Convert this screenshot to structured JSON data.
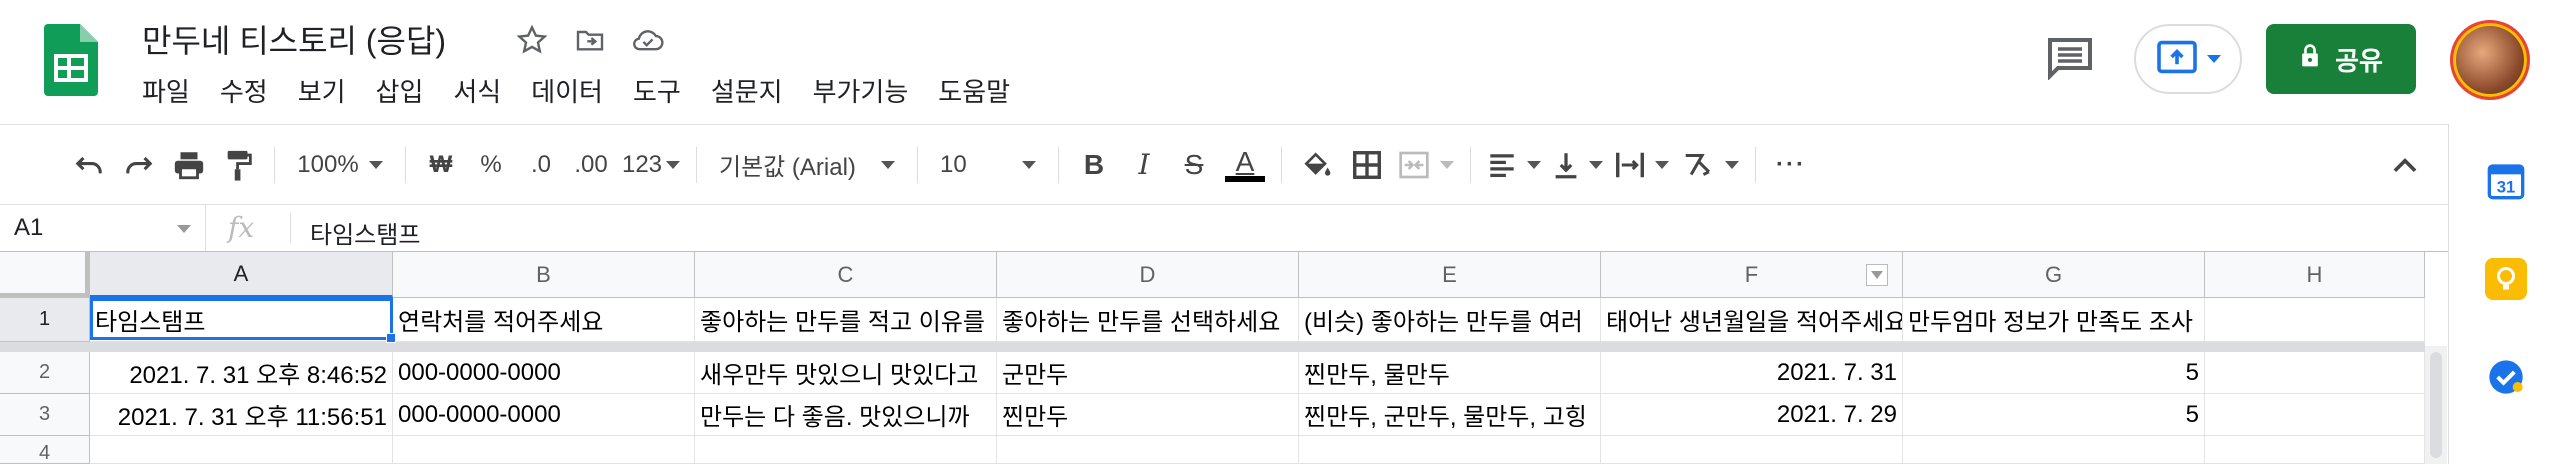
{
  "title": {
    "doc_title": "만두네 티스토리 (응답)"
  },
  "menu": [
    "파일",
    "수정",
    "보기",
    "삽입",
    "서식",
    "데이터",
    "도구",
    "설문지",
    "부가기능",
    "도움말"
  ],
  "header_buttons": {
    "share_label": "공유"
  },
  "toolbar": {
    "zoom": "100%",
    "currency": "₩",
    "percent": "%",
    "decimal_dec": ".0",
    "decimal_inc": ".00",
    "number_format": "123",
    "font_family": "기본값 (Arial)",
    "font_size": "10",
    "bold": "B",
    "italic": "I",
    "strike": "S",
    "text_color": "A",
    "more": "···"
  },
  "formula_bar": {
    "cell_ref": "A1",
    "fx": "fx",
    "value": "타임스탬프"
  },
  "columns": [
    "A",
    "B",
    "C",
    "D",
    "E",
    "F",
    "G",
    "H"
  ],
  "rows": [
    "1",
    "2",
    "3",
    "4"
  ],
  "cells": {
    "r1": [
      "타임스탬프",
      "연락처를 적어주세요",
      "좋아하는 만두를 적고 이유를",
      "좋아하는 만두를 선택하세요",
      "(비슷) 좋아하는 만두를 여러",
      "태어난 생년월일을 적어주세요",
      "만두엄마 정보가 만족도 조사"
    ],
    "r2": [
      "2021. 7. 31 오후 8:46:52",
      "000-0000-0000",
      "새우만두 맛있으니 맛있다고",
      "군만두",
      "찐만두, 물만두",
      "2021. 7. 31",
      "5"
    ],
    "r3": [
      "2021. 7. 31 오후 11:56:51",
      "000-0000-0000",
      "만두는 다 좋음. 맛있으니까",
      "찐만두",
      "찐만두, 군만두, 물만두, 고힝",
      "2021. 7. 29",
      "5"
    ]
  },
  "colors": {
    "brand_green": "#188038",
    "selection_blue": "#1a73e8"
  }
}
